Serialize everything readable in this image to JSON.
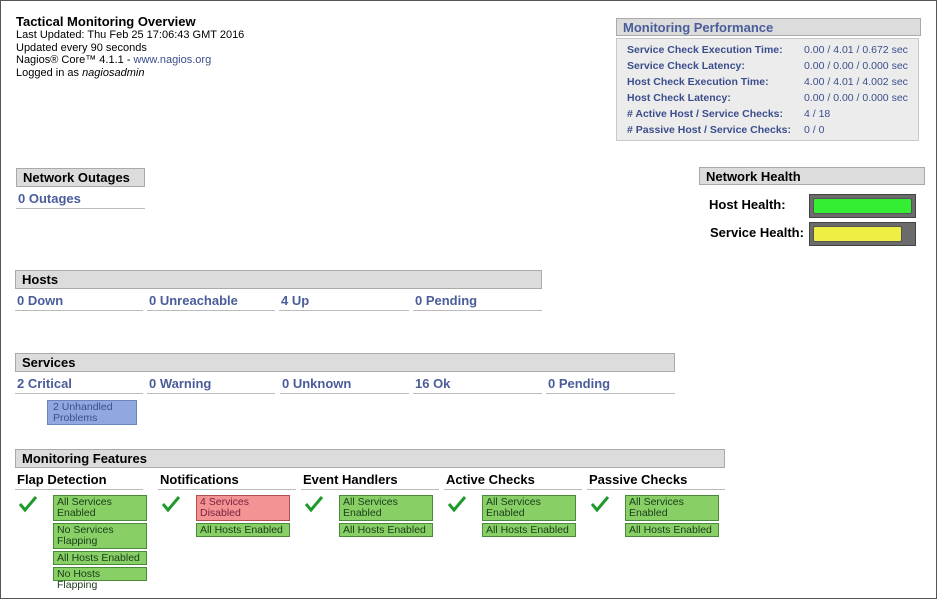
{
  "header": {
    "title": "Tactical Monitoring Overview",
    "last_updated": "Last Updated: Thu Feb 25 17:06:43 GMT 2016",
    "update_interval": "Updated every 90 seconds",
    "core_prefix": "Nagios® Core™ 4.1.1 - ",
    "core_link": "www.nagios.org",
    "logged_in_prefix": "Logged in as ",
    "user": "nagiosadmin"
  },
  "performance": {
    "title": "Monitoring Performance",
    "rows": [
      {
        "label": "Service Check Execution Time:",
        "value": "0.00 / 4.01 / 0.672 sec"
      },
      {
        "label": "Service Check Latency:",
        "value": "0.00 / 0.00 / 0.000 sec"
      },
      {
        "label": "Host Check Execution Time:",
        "value": "4.00 / 4.01 / 4.002 sec"
      },
      {
        "label": "Host Check Latency:",
        "value": "0.00 / 0.00 / 0.000 sec"
      },
      {
        "label": "# Active Host / Service Checks:",
        "value": "4 / 18"
      },
      {
        "label": "# Passive Host / Service Checks:",
        "value": "0 / 0"
      }
    ]
  },
  "outages": {
    "title": "Network Outages",
    "value": "0 Outages"
  },
  "health": {
    "title": "Network Health",
    "host_label": "Host Health:",
    "service_label": "Service Health:",
    "host_level": 1.0,
    "service_level": 0.9,
    "host_color": "#33ee33",
    "service_color": "#eeee44"
  },
  "hosts": {
    "title": "Hosts",
    "items": [
      "0 Down",
      "0 Unreachable",
      "4 Up",
      "0 Pending"
    ]
  },
  "services": {
    "title": "Services",
    "items": [
      "2 Critical",
      "0 Warning",
      "0 Unknown",
      "16 Ok",
      "0 Pending"
    ],
    "unhandled": "2 Unhandled Problems"
  },
  "features": {
    "title": "Monitoring Features",
    "columns": [
      {
        "title": "Flap Detection",
        "badges": [
          "All Services Enabled",
          "No Services Flapping",
          "All Hosts Enabled",
          "No Hosts Flapping"
        ]
      },
      {
        "title": "Notifications",
        "badges": [
          "4 Services Disabled",
          "All Hosts Enabled"
        ]
      },
      {
        "title": "Event Handlers",
        "badges": [
          "All Services Enabled",
          "All Hosts Enabled"
        ]
      },
      {
        "title": "Active Checks",
        "badges": [
          "All Services Enabled",
          "All Hosts Enabled"
        ]
      },
      {
        "title": "Passive Checks",
        "badges": [
          "All Services Enabled",
          "All Hosts Enabled"
        ]
      }
    ]
  },
  "colors": {
    "link": "#4a5d9a",
    "ok": "#88d066",
    "critical": "#f39393",
    "unhandled": "#8fa9e0"
  }
}
